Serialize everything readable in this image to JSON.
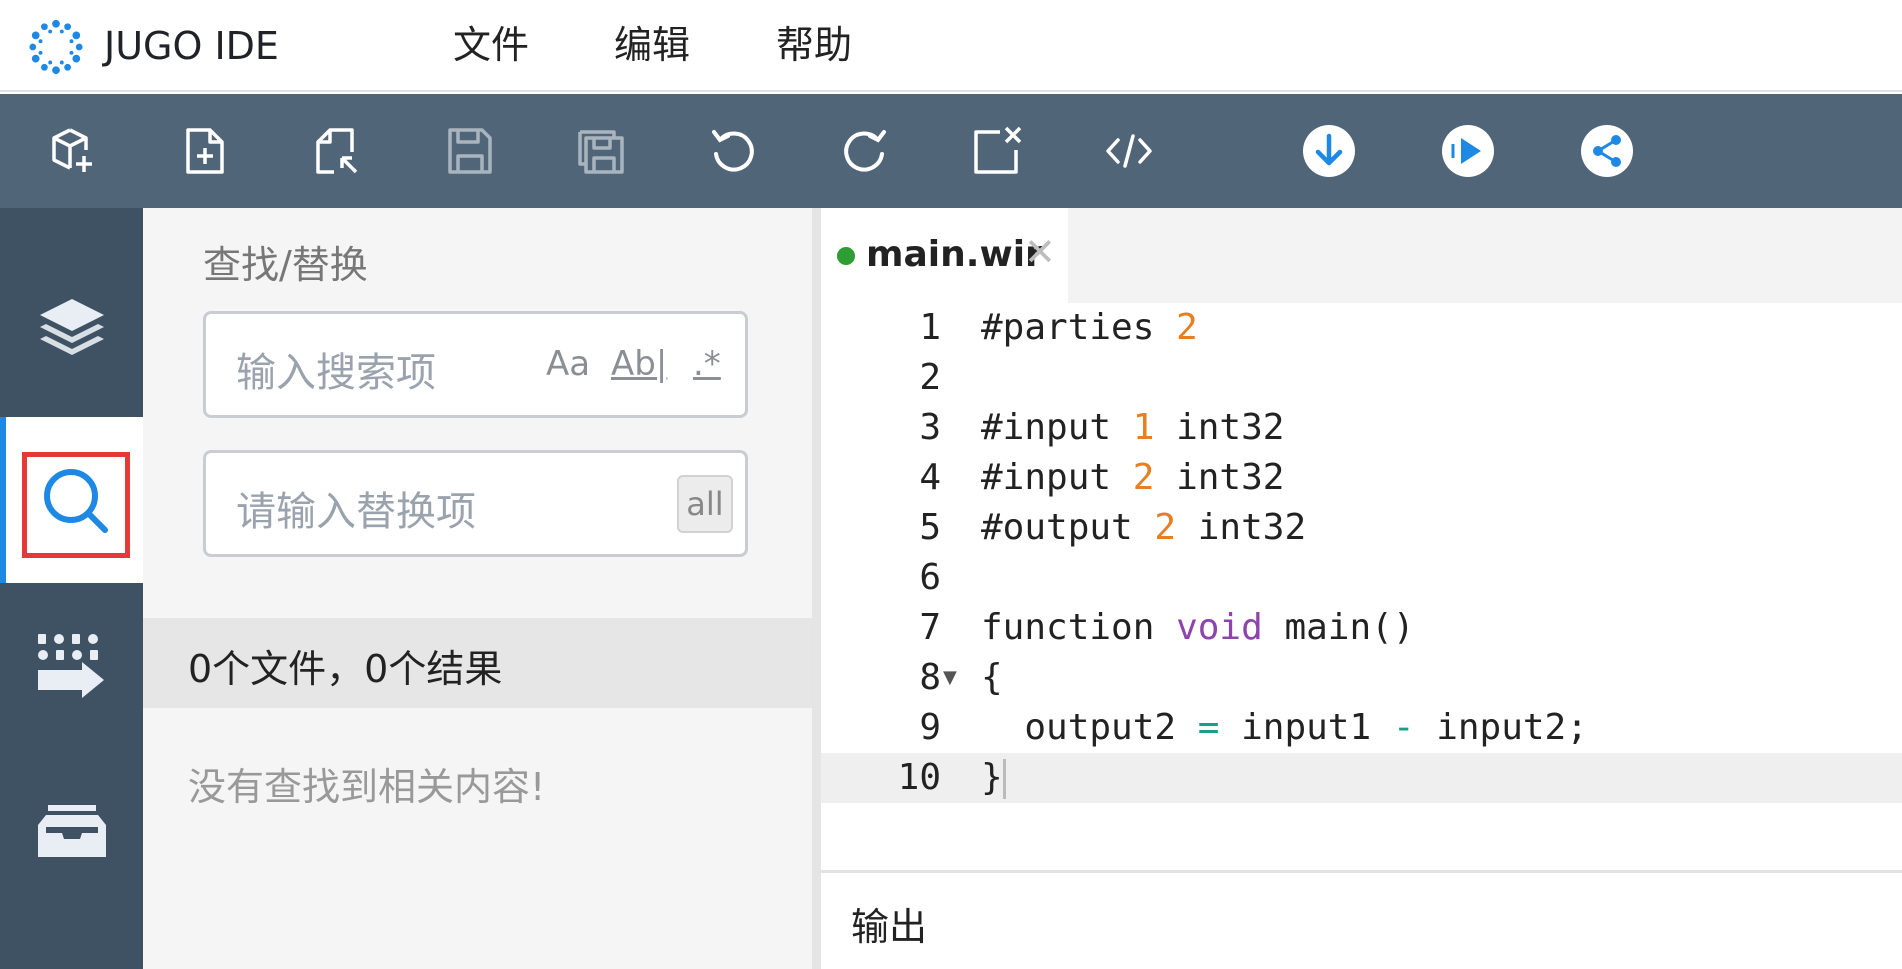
{
  "app": {
    "title": "JUGO IDE"
  },
  "menu": {
    "items": [
      "文件",
      "编辑",
      "帮助"
    ]
  },
  "toolbar": {
    "buttons": [
      "new-project-icon",
      "new-file-icon",
      "open-file-icon",
      "save-icon",
      "save-all-icon",
      "undo-icon",
      "redo-icon",
      "close-file-icon",
      "format-code-icon",
      "download-icon",
      "run-icon",
      "share-icon"
    ]
  },
  "activity_bar": {
    "items": [
      "layers-icon",
      "search-icon",
      "compile-icon",
      "inbox-icon"
    ],
    "active": "search-icon"
  },
  "search_panel": {
    "title": "查找/替换",
    "search_placeholder": "输入搜索项",
    "match_case_label": "Aa",
    "whole_word_label": "Ab|",
    "regex_label": ".*",
    "replace_placeholder": "请输入替换项",
    "replace_all_label": "all",
    "result_summary": "0个文件，0个结果",
    "empty_message": "没有查找到相关内容!"
  },
  "editor": {
    "tab": {
      "filename": "main.wir",
      "close": "✕"
    },
    "current_line": 10,
    "lines": [
      {
        "n": "1",
        "code": "#parties 2"
      },
      {
        "n": "2",
        "code": ""
      },
      {
        "n": "3",
        "code": "#input 1 int32"
      },
      {
        "n": "4",
        "code": "#input 2 int32"
      },
      {
        "n": "5",
        "code": "#output 2 int32"
      },
      {
        "n": "6",
        "code": ""
      },
      {
        "n": "7",
        "code": "function void main()"
      },
      {
        "n": "8",
        "code": "{"
      },
      {
        "n": "9",
        "code": "  output2 = input1 - input2;"
      },
      {
        "n": "10",
        "code": "}"
      }
    ]
  },
  "output_panel": {
    "title": "输出"
  },
  "colors": {
    "toolbar": "#516579",
    "activity_bar": "#3f5264",
    "accent": "#1e88e5",
    "number": "#e67e22",
    "keyword": "#8e44ad",
    "focus": "#e53935"
  }
}
